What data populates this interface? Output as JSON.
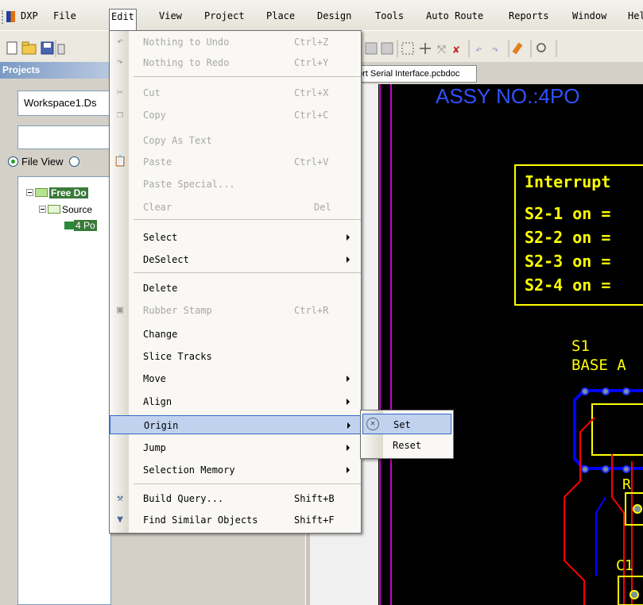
{
  "menubar": {
    "items": [
      {
        "label": "DXP",
        "key": "X"
      },
      {
        "label": "File",
        "key": "F"
      },
      {
        "label": "Edit",
        "key": "E"
      },
      {
        "label": "View",
        "key": "V"
      },
      {
        "label": "Project",
        "key": "c"
      },
      {
        "label": "Place",
        "key": "P"
      },
      {
        "label": "Design",
        "key": "D"
      },
      {
        "label": "Tools",
        "key": "T"
      },
      {
        "label": "Auto Route",
        "key": "A"
      },
      {
        "label": "Reports",
        "key": "R"
      },
      {
        "label": "Window",
        "key": "W"
      },
      {
        "label": "Hel"
      }
    ]
  },
  "projects_panel": {
    "title": "Projects",
    "workspace": "Workspace1.Ds",
    "views": [
      "File View"
    ],
    "tree": [
      {
        "label": "Free Do",
        "level": 0
      },
      {
        "label": "Source",
        "level": 1
      },
      {
        "label": "4 Po",
        "level": 2
      }
    ]
  },
  "document_tab": "ort Serial Interface.pcbdoc",
  "pcb": {
    "assy_text": "ASSY NO.:4PO",
    "interrupt_title": "Interrupt",
    "switch_lines": [
      "S2-1 on =",
      "S2-2 on =",
      "S2-3 on =",
      "S2-4 on ="
    ],
    "s1_label": "S1",
    "base_label": "BASE A",
    "r_label": "R",
    "c1_label": "C1"
  },
  "edit_menu": {
    "items": [
      {
        "label": "Nothing to Undo",
        "shortcut": "Ctrl+Z",
        "disabled": true,
        "icon": "undo-icon"
      },
      {
        "label": "Nothing to Redo",
        "shortcut": "Ctrl+Y",
        "disabled": true,
        "icon": "redo-icon"
      },
      {
        "label": "Cut",
        "shortcut": "Ctrl+X",
        "disabled": true,
        "icon": "cut-icon"
      },
      {
        "label": "Copy",
        "shortcut": "Ctrl+C",
        "disabled": true,
        "icon": "copy-icon"
      },
      {
        "label": "Copy As Text",
        "shortcut": "",
        "disabled": true
      },
      {
        "label": "Paste",
        "shortcut": "Ctrl+V",
        "disabled": true,
        "icon": "paste-icon"
      },
      {
        "label": "Paste Special...",
        "shortcut": "",
        "disabled": true
      },
      {
        "label": "Clear",
        "shortcut": "Del",
        "disabled": true
      },
      {
        "label": "Select",
        "submenu": true
      },
      {
        "label": "DeSelect",
        "submenu": true
      },
      {
        "label": "Delete"
      },
      {
        "label": "Rubber Stamp",
        "shortcut": "Ctrl+R",
        "disabled": true,
        "icon": "rubber-stamp-icon"
      },
      {
        "label": "Change"
      },
      {
        "label": "Slice Tracks"
      },
      {
        "label": "Move",
        "submenu": true
      },
      {
        "label": "Align",
        "submenu": true
      },
      {
        "label": "Origin",
        "submenu": true,
        "highlighted": true
      },
      {
        "label": "Jump",
        "submenu": true
      },
      {
        "label": "Selection Memory",
        "submenu": true
      },
      {
        "label": "Build Query...",
        "shortcut": "Shift+B",
        "icon": "build-query-icon"
      },
      {
        "label": "Find Similar Objects",
        "shortcut": "Shift+F",
        "icon": "funnel-icon"
      }
    ]
  },
  "origin_submenu": {
    "items": [
      {
        "label": "Set",
        "highlighted": true,
        "icon": "origin-set-icon"
      },
      {
        "label": "Reset"
      }
    ]
  },
  "colors": {
    "menu_highlight": "#c1d2ee",
    "menu_highlight_border": "#316ac5",
    "pcb_background": "#000000",
    "pcb_yellow": "#ffff00",
    "pcb_red": "#ff0000",
    "pcb_blue": "#0000ff",
    "pcb_magenta": "#cc00cc"
  }
}
